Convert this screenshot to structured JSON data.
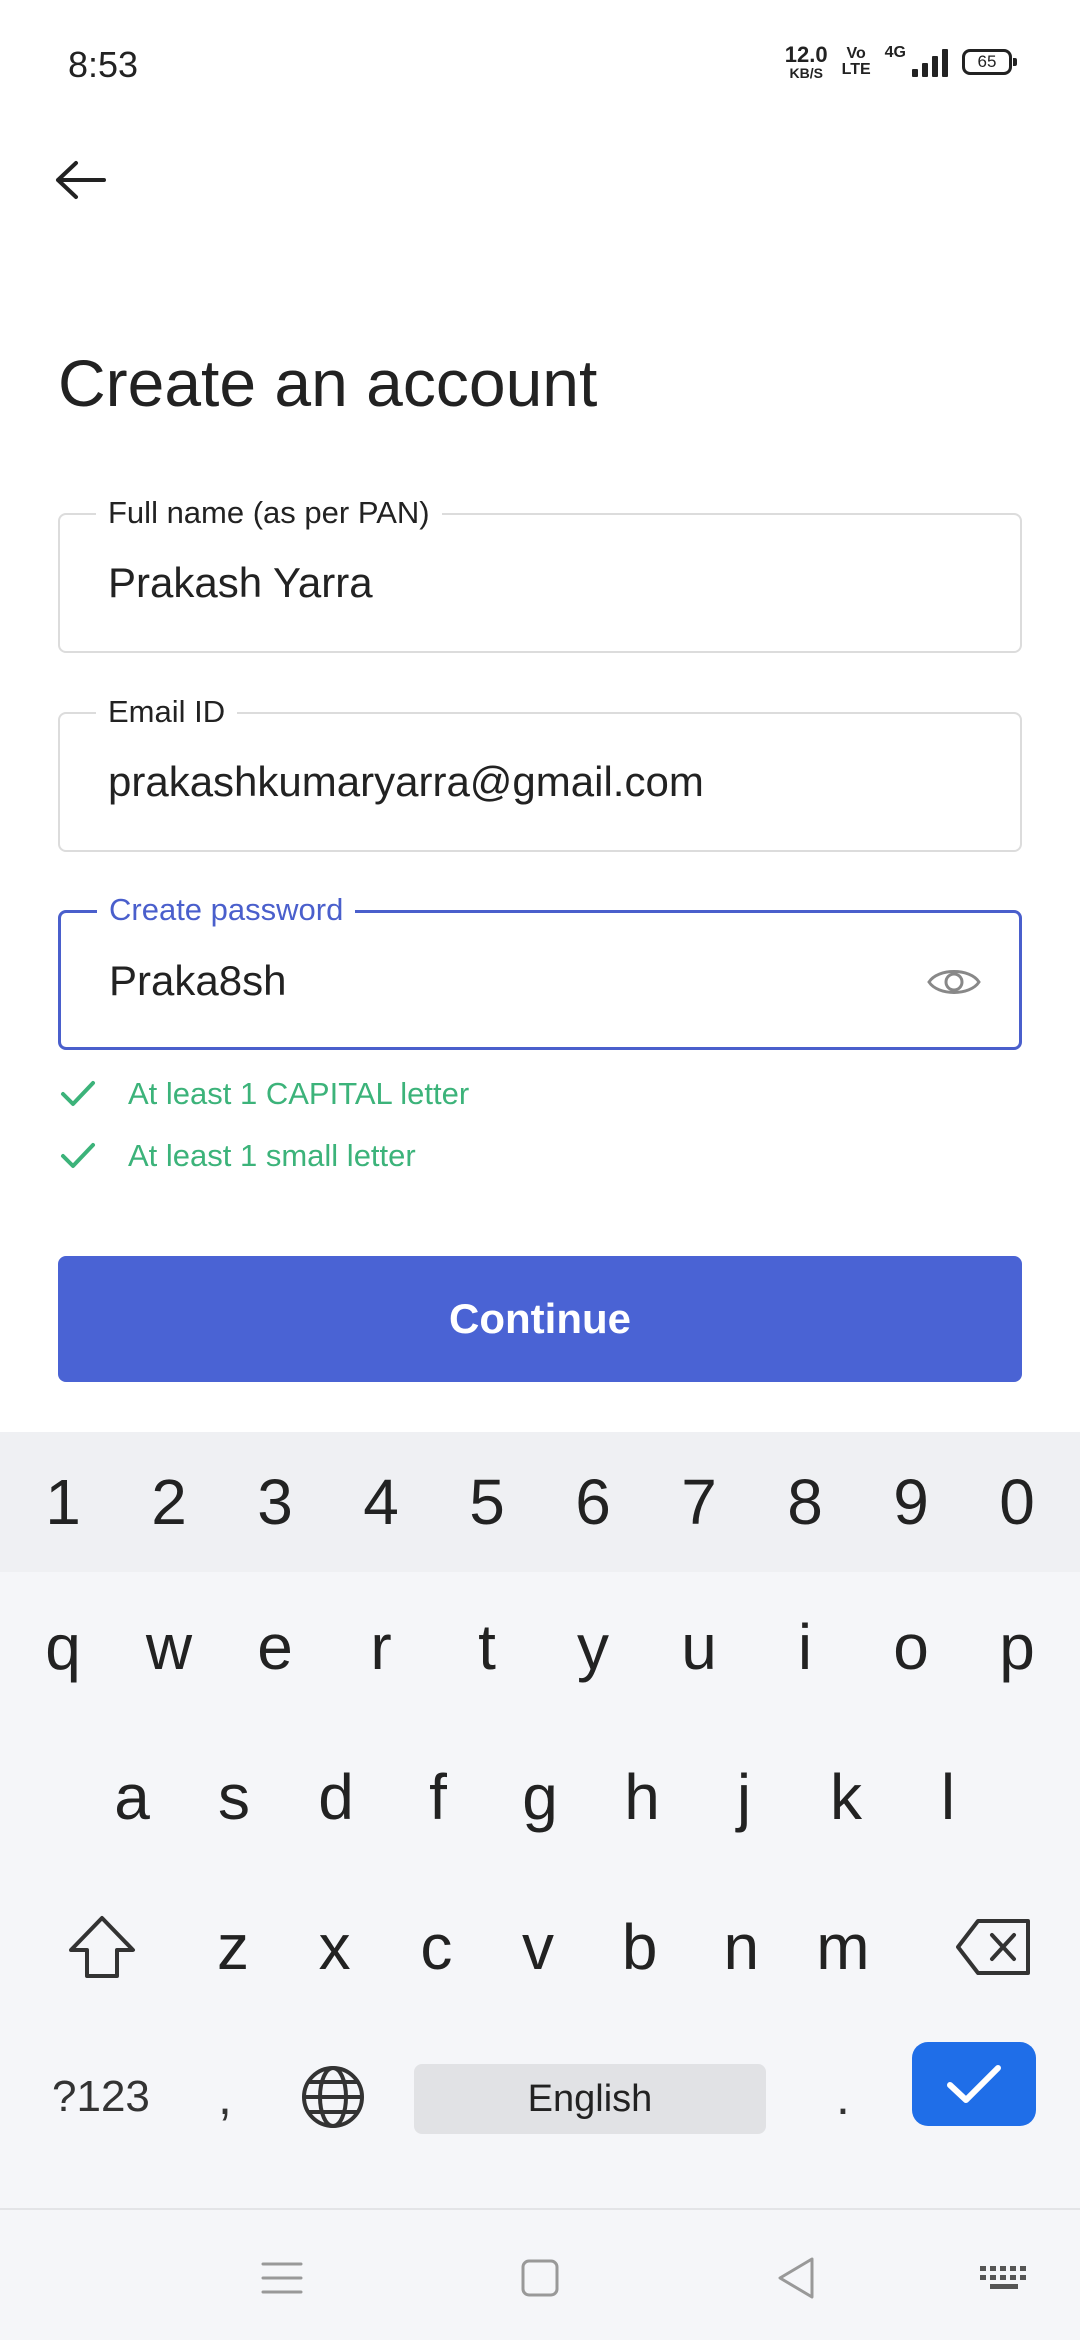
{
  "status_bar": {
    "time": "8:53",
    "net_speed_value": "12.0",
    "net_speed_unit": "KB/S",
    "volte_top": "Vo",
    "volte_bottom": "LTE",
    "network_type": "4G",
    "battery": "65"
  },
  "page": {
    "title": "Create an account"
  },
  "form": {
    "full_name": {
      "label": "Full name (as per PAN)",
      "value": "Prakash Yarra"
    },
    "email": {
      "label": "Email ID",
      "value": "prakashkumaryarra@gmail.com"
    },
    "password": {
      "label": "Create password",
      "value": "Praka8sh"
    }
  },
  "password_rules": [
    {
      "text": "At least 1 CAPITAL letter",
      "met": true
    },
    {
      "text": "At least 1 small letter",
      "met": true
    }
  ],
  "continue_label": "Continue",
  "keyboard": {
    "numbers": [
      "1",
      "2",
      "3",
      "4",
      "5",
      "6",
      "7",
      "8",
      "9",
      "0"
    ],
    "row1": [
      "q",
      "w",
      "e",
      "r",
      "t",
      "y",
      "u",
      "i",
      "o",
      "p"
    ],
    "row2": [
      "a",
      "s",
      "d",
      "f",
      "g",
      "h",
      "j",
      "k",
      "l"
    ],
    "row3": [
      "z",
      "x",
      "c",
      "v",
      "b",
      "n",
      "m"
    ],
    "symbols_label": "?123",
    "comma": ",",
    "space_label": "English",
    "period": "."
  },
  "colors": {
    "accent": "#4a63d4",
    "success": "#3cb37a",
    "enter_key": "#1f6ee8"
  }
}
